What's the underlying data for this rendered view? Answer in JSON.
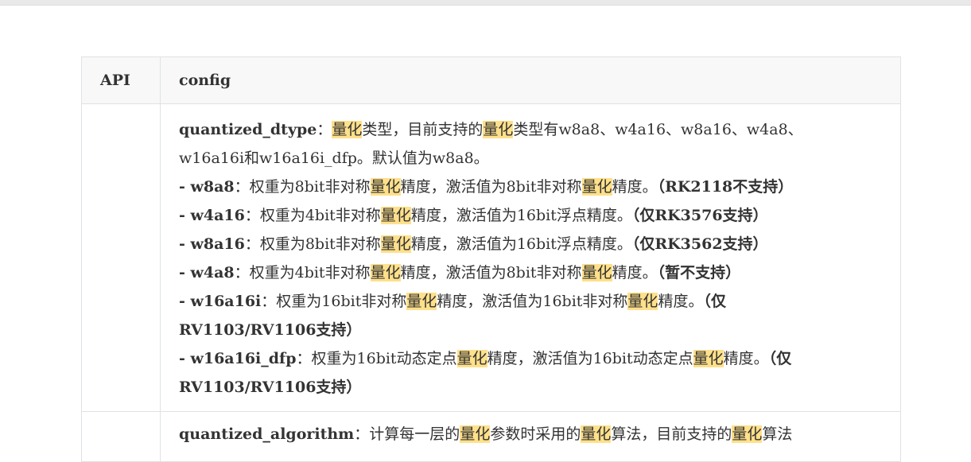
{
  "header": {
    "col_api": "API",
    "col_config": "config"
  },
  "rows": [
    {
      "api": "",
      "lines": [
        {
          "segments": [
            {
              "t": "quantized_dtype",
              "b": true
            },
            {
              "t": "：",
              "b": false
            },
            {
              "t": "量化",
              "m": true
            },
            {
              "t": "类型，目前支持的",
              "b": false
            },
            {
              "t": "量化",
              "m": true
            },
            {
              "t": "类型有w8a8、w4a16、w8a16、w4a8、",
              "b": false
            }
          ]
        },
        {
          "segments": [
            {
              "t": "w16a16i和w16a16i_dfp。默认值为w8a8。",
              "b": false
            }
          ]
        },
        {
          "segments": [
            {
              "t": "- w8a8",
              "b": true
            },
            {
              "t": "：权重为8bit非对称",
              "b": false
            },
            {
              "t": "量化",
              "m": true
            },
            {
              "t": "精度，激活值为8bit非对称",
              "b": false
            },
            {
              "t": "量化",
              "m": true
            },
            {
              "t": "精度。",
              "b": false
            },
            {
              "t": "（RK2118不支持）",
              "b": true
            }
          ]
        },
        {
          "segments": [
            {
              "t": "- w4a16",
              "b": true
            },
            {
              "t": "：权重为4bit非对称",
              "b": false
            },
            {
              "t": "量化",
              "m": true
            },
            {
              "t": "精度，激活值为16bit浮点精度。",
              "b": false
            },
            {
              "t": "（仅RK3576支持）",
              "b": true
            }
          ]
        },
        {
          "segments": [
            {
              "t": "- w8a16",
              "b": true
            },
            {
              "t": "：权重为8bit非对称",
              "b": false
            },
            {
              "t": "量化",
              "m": true
            },
            {
              "t": "精度，激活值为16bit浮点精度。",
              "b": false
            },
            {
              "t": "（仅RK3562支持）",
              "b": true
            }
          ]
        },
        {
          "segments": [
            {
              "t": "- w4a8",
              "b": true
            },
            {
              "t": "：权重为4bit非对称",
              "b": false
            },
            {
              "t": "量化",
              "m": true
            },
            {
              "t": "精度，激活值为8bit非对称",
              "b": false
            },
            {
              "t": "量化",
              "m": true
            },
            {
              "t": "精度。",
              "b": false
            },
            {
              "t": "（暂不支持）",
              "b": true
            }
          ]
        },
        {
          "segments": [
            {
              "t": "- w16a16i",
              "b": true
            },
            {
              "t": "：权重为16bit非对称",
              "b": false
            },
            {
              "t": "量化",
              "m": true
            },
            {
              "t": "精度，激活值为16bit非对称",
              "b": false
            },
            {
              "t": "量化",
              "m": true
            },
            {
              "t": "精度。",
              "b": false
            },
            {
              "t": "（仅",
              "b": true
            }
          ]
        },
        {
          "segments": [
            {
              "t": "RV1103/RV1106支持）",
              "b": true
            }
          ]
        },
        {
          "segments": [
            {
              "t": "- w16a16i_dfp",
              "b": true
            },
            {
              "t": "：权重为16bit动态定点",
              "b": false
            },
            {
              "t": "量化",
              "m": true
            },
            {
              "t": "精度，激活值为16bit动态定点",
              "b": false
            },
            {
              "t": "量化",
              "m": true
            },
            {
              "t": "精度。",
              "b": false
            },
            {
              "t": "（仅",
              "b": true
            }
          ]
        },
        {
          "segments": [
            {
              "t": "RV1103/RV1106支持）",
              "b": true
            }
          ]
        }
      ]
    },
    {
      "api": "",
      "lines": [
        {
          "segments": [
            {
              "t": "quantized_algorithm",
              "b": true
            },
            {
              "t": "：计算每一层的",
              "b": false
            },
            {
              "t": "量化",
              "m": true
            },
            {
              "t": "参数时采用的",
              "b": false
            },
            {
              "t": "量化",
              "m": true
            },
            {
              "t": "算法，目前支持的",
              "b": false
            },
            {
              "t": "量化",
              "m": true
            },
            {
              "t": "算法",
              "b": false
            }
          ]
        }
      ]
    }
  ]
}
